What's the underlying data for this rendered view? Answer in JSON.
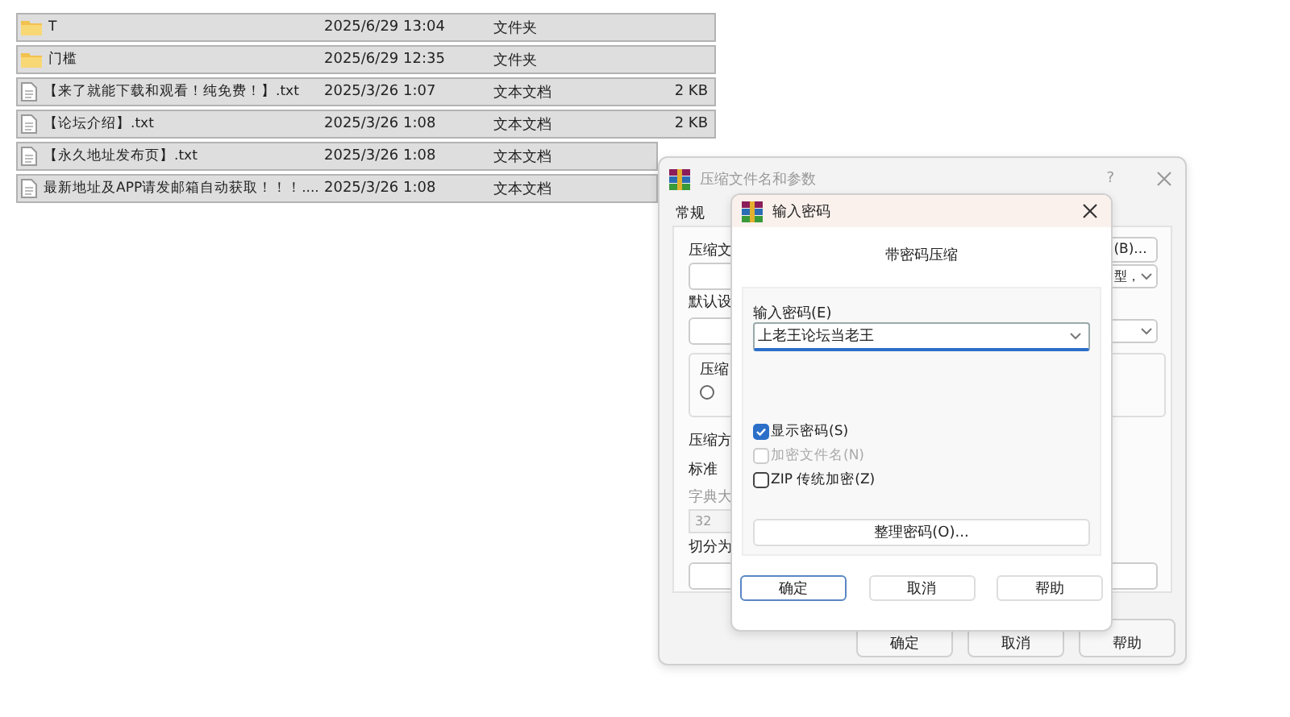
{
  "files": [
    {
      "kind": "folder",
      "name": "T",
      "date": "2025/6/29 13:04",
      "type": "文件夹"
    },
    {
      "kind": "folder",
      "name": "门槛",
      "date": "2025/6/29 12:35",
      "type": "文件夹"
    },
    {
      "kind": "text",
      "name": "【来了就能下载和观看！纯免费！】.txt",
      "date": "2025/3/26 1:07",
      "type": "文本文档",
      "size": "2 KB"
    },
    {
      "kind": "text",
      "name": "【论坛介绍】.txt",
      "date": "2025/3/26 1:08",
      "type": "文本文档",
      "size": "2 KB"
    },
    {
      "kind": "text",
      "name": "【永久地址发布页】.txt",
      "date": "2025/3/26 1:08",
      "type": "文本文档"
    },
    {
      "kind": "text",
      "name": "最新地址及APP请发邮箱自动获取！！！....",
      "date": "2025/3/26 1:08",
      "type": "文本文档"
    }
  ],
  "archive_dialog": {
    "title": "压缩文件名和参数",
    "help": "?",
    "tab": "常规",
    "left_labels": [
      "压缩文",
      "默认设",
      "压缩方",
      "字典大",
      "切分为"
    ],
    "browse_button": "(B)...",
    "radio_selected": false,
    "combo_value": "型，",
    "group_label": "压缩",
    "method_value": "标准",
    "dict_value": "32",
    "buttons": [
      "确定",
      "取消",
      "帮助"
    ]
  },
  "password_dialog": {
    "title": "输入密码",
    "heading": "带密码压缩",
    "field_label": "输入密码(E)",
    "password": "上老王论坛当老王",
    "options": [
      {
        "label": "显示密码(S)",
        "checked": true,
        "disabled": false
      },
      {
        "label": "加密文件名(N)",
        "checked": false,
        "disabled": true
      },
      {
        "label": "ZIP 传统加密(Z)",
        "checked": false,
        "disabled": false
      }
    ],
    "organize_button": "整理密码(O)...",
    "buttons": [
      {
        "label": "确定",
        "selected": true
      },
      {
        "label": "取消",
        "selected": false
      },
      {
        "label": "帮助",
        "selected": false
      }
    ]
  }
}
